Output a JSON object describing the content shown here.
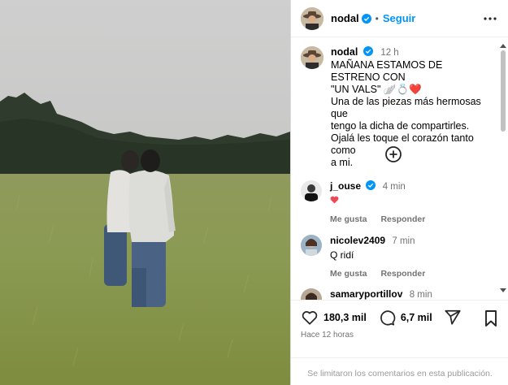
{
  "post": {
    "username": "nodal",
    "follow_label": "Seguir",
    "dot": "•"
  },
  "caption": {
    "username": "nodal",
    "time": "12 h",
    "line1": "MAÑANA ESTAMOS DE ESTRENO CON",
    "line2": "\"UN VALS\" 🪽💍❤️",
    "line3": "Una de las piezas más hermosas que",
    "line4": "tengo la dicha de compartirles.",
    "line5": "Ojalá les toque el corazón tanto como",
    "line6": "a mi."
  },
  "comments": [
    {
      "username": "j_ouse",
      "verified": true,
      "time": "4 min",
      "text": "",
      "like_label": "Me gusta",
      "reply_label": "Responder"
    },
    {
      "username": "nicolev2409",
      "verified": false,
      "time": "7 min",
      "text": "Q ridí",
      "like_label": "Me gusta",
      "reply_label": "Responder"
    },
    {
      "username": "samaryportillov",
      "verified": false,
      "time": "8 min",
      "text": ""
    }
  ],
  "stats": {
    "likes": "180,3 mil",
    "comments": "6,7 mil",
    "posted_ago": "Hace 12 horas"
  },
  "comments_limited_notice": "Se limitaron los comentarios en esta publicación.",
  "colors": {
    "accent": "#0095f6",
    "verified": "#0095f6",
    "heart": "#ed4956"
  },
  "icons": [
    "more-icon",
    "verified-icon",
    "add-circle-icon",
    "heart-icon",
    "comment-icon",
    "share-icon",
    "bookmark-icon"
  ]
}
